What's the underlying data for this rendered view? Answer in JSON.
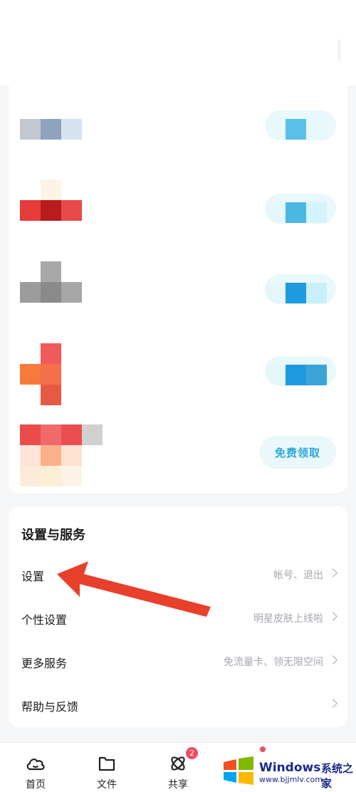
{
  "promo": {
    "claim_button": "免费领取"
  },
  "settings": {
    "title": "设置与服务",
    "rows": [
      {
        "label": "设置",
        "hint": "帐号、退出"
      },
      {
        "label": "个性设置",
        "hint": "明星皮肤上线啦"
      },
      {
        "label": "更多服务",
        "hint": "免流量卡、领无限空间"
      },
      {
        "label": "帮助与反馈",
        "hint": ""
      }
    ]
  },
  "tabbar": {
    "tabs": [
      {
        "label": "首页",
        "icon": "cloud-icon"
      },
      {
        "label": "文件",
        "icon": "folder-icon"
      },
      {
        "label": "共享",
        "icon": "share-icon",
        "badge": "2"
      }
    ]
  },
  "watermark": {
    "brand": "Windows",
    "cn": "系统之家",
    "url": "www.bjjmlv.com"
  },
  "colors": {
    "accent": "#2aa8d8",
    "arrow": "#e8402a",
    "badge": "#f24b63"
  }
}
